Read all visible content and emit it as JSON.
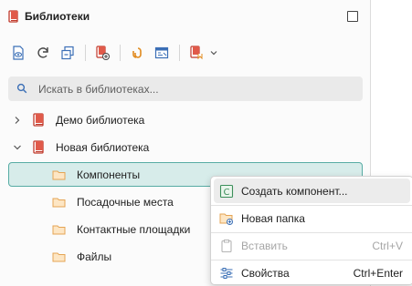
{
  "colors": {
    "accent": "#57aca4",
    "selection_bg": "#d7ecea",
    "library_red": "#c0392b",
    "folder": "#f3c58a",
    "toolbar_blue": "#3b6fb6",
    "toolbar_orange": "#e08a1e"
  },
  "header": {
    "title": "Библиотеки",
    "icon": "library-book-icon",
    "close_icon": "maximize-square-icon"
  },
  "toolbar": {
    "items": [
      {
        "icon": "view-eye-document-icon"
      },
      {
        "icon": "refresh-icon"
      },
      {
        "icon": "collapse-all-icon"
      },
      {
        "icon": "add-library-icon"
      },
      {
        "icon": "link-icon"
      },
      {
        "icon": "open-library-icon"
      },
      {
        "icon": "export-library-icon"
      },
      {
        "icon": "dropdown-chevron-icon"
      }
    ]
  },
  "search": {
    "placeholder": "Искать в библиотеках...",
    "value": "",
    "icon": "search-icon"
  },
  "tree": {
    "items": [
      {
        "label": "Демо библиотека",
        "type": "library",
        "expanded": false
      },
      {
        "label": "Новая библиотека",
        "type": "library",
        "expanded": true
      },
      {
        "label": "Компоненты",
        "type": "folder",
        "selected": true
      },
      {
        "label": "Посадочные места",
        "type": "folder"
      },
      {
        "label": "Контактные площадки",
        "type": "folder"
      },
      {
        "label": "Файлы",
        "type": "folder"
      }
    ]
  },
  "context_menu": {
    "items": [
      {
        "label": "Создать компонент...",
        "shortcut": "",
        "icon": "component-c-icon",
        "enabled": true,
        "hovered": true
      },
      {
        "label": "Новая папка",
        "shortcut": "",
        "icon": "new-folder-icon",
        "enabled": true
      },
      {
        "label": "Вставить",
        "shortcut": "Ctrl+V",
        "icon": "paste-clipboard-icon",
        "enabled": false
      },
      {
        "label": "Свойства",
        "shortcut": "Ctrl+Enter",
        "icon": "properties-sliders-icon",
        "enabled": true
      }
    ]
  }
}
